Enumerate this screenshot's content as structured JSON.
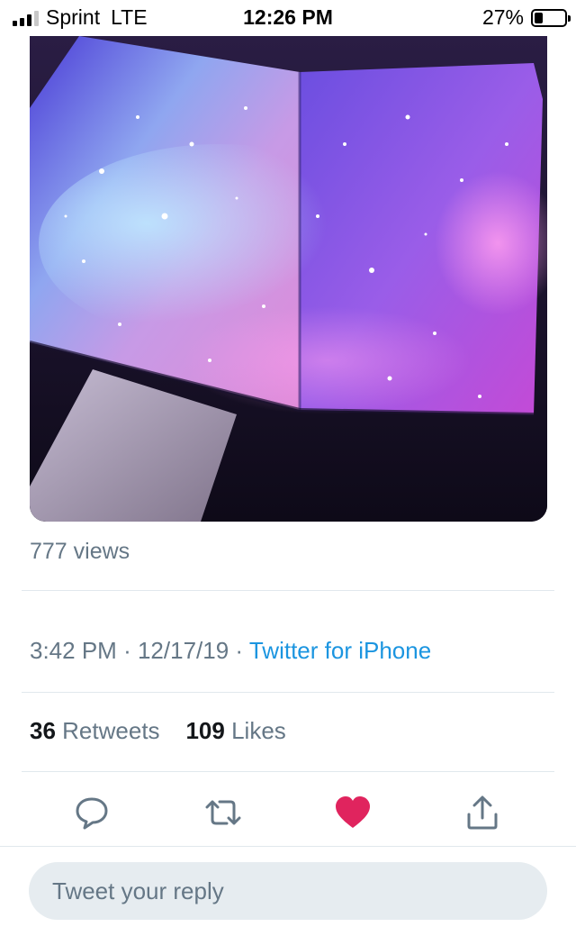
{
  "status_bar": {
    "carrier": "Sprint",
    "network": "LTE",
    "time": "12:26 PM",
    "battery": "27%",
    "battery_level": 0.27
  },
  "tweet": {
    "views": "777 views",
    "time": "3:42 PM",
    "date": "12/17/19",
    "separator": "·",
    "source": "Twitter for iPhone",
    "retweets_count": "36",
    "retweets_label": "Retweets",
    "likes_count": "109",
    "likes_label": "Likes",
    "liked": true
  },
  "actions": {
    "reply_icon": "reply-icon",
    "retweet_icon": "retweet-icon",
    "like_icon": "heart-icon",
    "share_icon": "share-icon"
  },
  "reply": {
    "placeholder": "Tweet your reply"
  },
  "colors": {
    "accent": "#1b95e0",
    "muted": "#657786",
    "like": "#e0245e",
    "reply_box_bg": "#e6ecf0"
  }
}
